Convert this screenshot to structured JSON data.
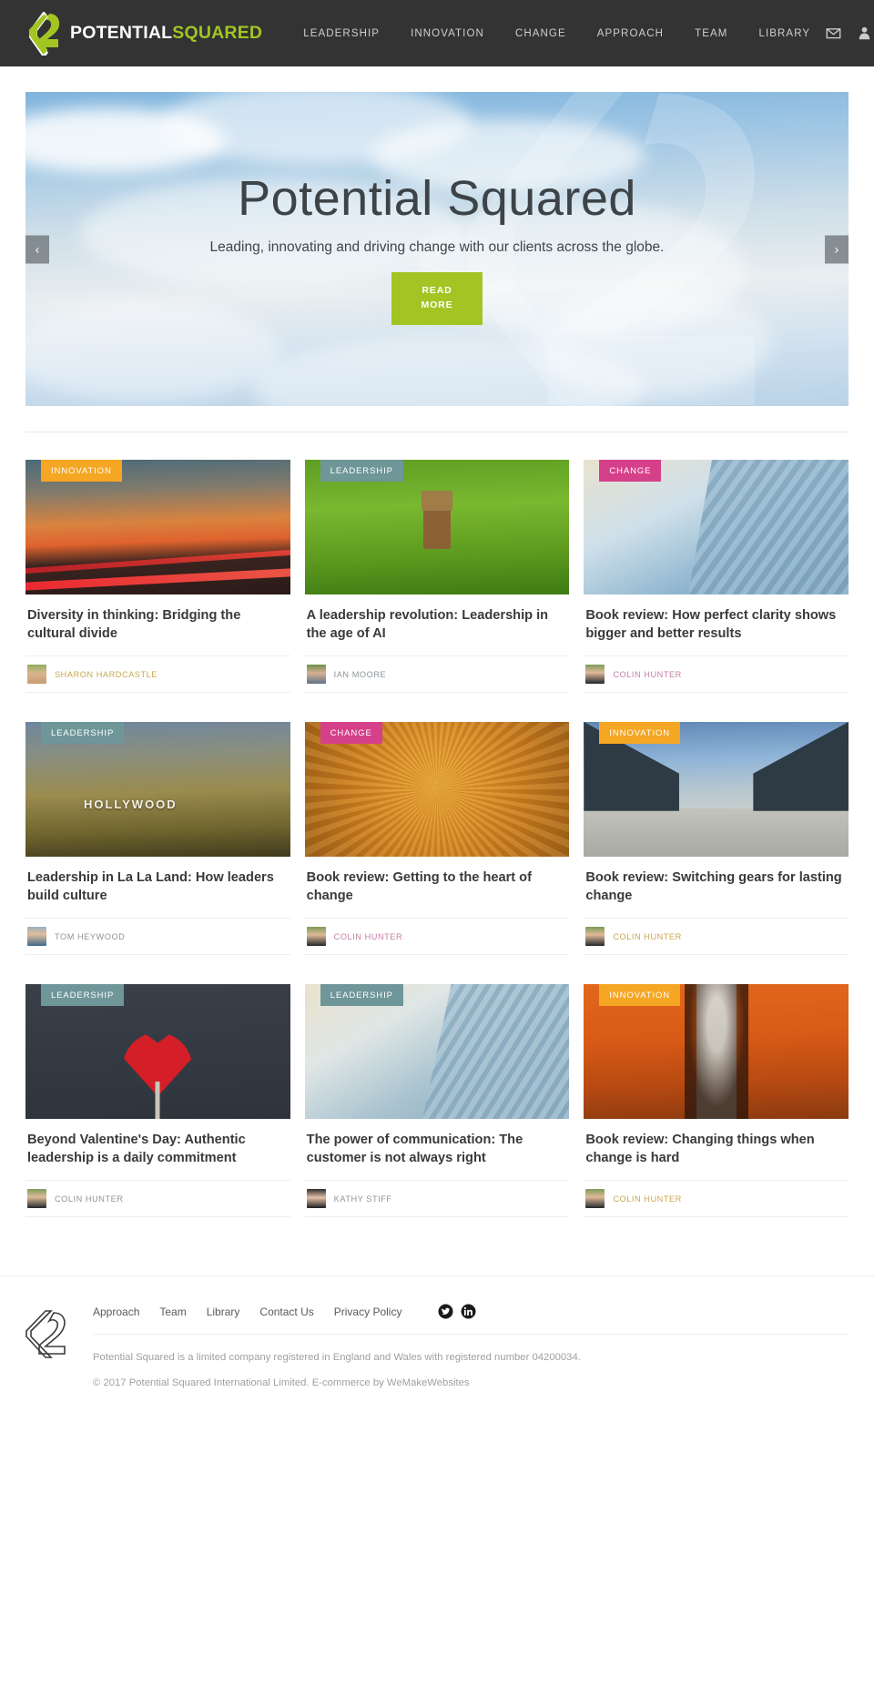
{
  "header": {
    "logo": {
      "part1": "POTENTIAL",
      "part2": "SQUARED",
      "icon": "p-squared-logo-icon"
    },
    "nav": [
      {
        "label": "LEADERSHIP"
      },
      {
        "label": "INNOVATION"
      },
      {
        "label": "CHANGE"
      },
      {
        "label": "APPROACH"
      },
      {
        "label": "TEAM"
      },
      {
        "label": "LIBRARY"
      }
    ],
    "icons": [
      {
        "name": "mail-icon"
      },
      {
        "name": "user-account-icon"
      },
      {
        "name": "search-icon"
      }
    ],
    "colors": {
      "background": "#333333",
      "accent": "#a2c523",
      "nav_text": "#cfcfcf"
    }
  },
  "hero": {
    "title": "Potential Squared",
    "subtitle": "Leading, innovating and driving change with our clients across the globe.",
    "cta_line1": "READ",
    "cta_line2": "MORE",
    "prev_label": "‹",
    "next_label": "›",
    "cta_color": "#a2c523"
  },
  "categories": {
    "innovation": {
      "label": "INNOVATION",
      "color": "#f5a623"
    },
    "leadership": {
      "label": "LEADERSHIP",
      "color": "#6f9699"
    },
    "change": {
      "label": "CHANGE",
      "color": "#d6408a"
    }
  },
  "articles": [
    {
      "category": "INNOVATION",
      "category_key": "innovation",
      "title": "Diversity in thinking: Bridging the cultural divide",
      "author": "SHARON HARDCASTLE",
      "author_color": "#c9a74e",
      "image": "bridge-sunset-light-trails-photo"
    },
    {
      "category": "LEADERSHIP",
      "category_key": "leadership",
      "title": "A leadership revolution: Leadership in the age of AI",
      "author": "IAN MOORE",
      "author_color": "#8d9499",
      "image": "wooden-robot-on-grass-photo"
    },
    {
      "category": "CHANGE",
      "category_key": "change",
      "title": "Book review: How perfect clarity shows bigger and better results",
      "author": "COLIN HUNTER",
      "author_color": "#c47fa5",
      "image": "glass-skyscrapers-upward-photo"
    },
    {
      "category": "LEADERSHIP",
      "category_key": "leadership",
      "title": "Leadership in La La Land: How leaders build culture",
      "author": "TOM HEYWOOD",
      "author_color": "#8d9499",
      "image": "hollywood-sign-hills-photo"
    },
    {
      "category": "CHANGE",
      "category_key": "change",
      "title": "Book review: Getting to the heart of change",
      "author": "COLIN HUNTER",
      "author_color": "#c47fa5",
      "image": "golden-spiral-tunnel-photo"
    },
    {
      "category": "INNOVATION",
      "category_key": "innovation",
      "title": "Book review: Switching gears for lasting change",
      "author": "COLIN HUNTER",
      "author_color": "#c9a74e",
      "image": "converging-metal-walls-walkway-photo"
    },
    {
      "category": "LEADERSHIP",
      "category_key": "leadership",
      "title": "Beyond Valentine's Day: Authentic leadership is a daily commitment",
      "author": "COLIN HUNTER",
      "author_color": "#8d9499",
      "image": "red-heart-lollipop-on-dark-photo"
    },
    {
      "category": "LEADERSHIP",
      "category_key": "leadership",
      "title": "The power of communication: The customer is not always right",
      "author": "KATHY STIFF",
      "author_color": "#8d9499",
      "image": "glass-skyscraper-clouds-photo"
    },
    {
      "category": "INNOVATION",
      "category_key": "innovation",
      "title": "Book review: Changing things when change is hard",
      "author": "COLIN HUNTER",
      "author_color": "#c9a74e",
      "image": "orange-torii-gates-path-photo"
    }
  ],
  "footer": {
    "logo_icon": "p-squared-outline-logo-icon",
    "links": [
      {
        "label": "Approach"
      },
      {
        "label": "Team"
      },
      {
        "label": "Library"
      },
      {
        "label": "Contact Us"
      },
      {
        "label": "Privacy Policy"
      }
    ],
    "social": [
      {
        "name": "twitter-icon"
      },
      {
        "name": "linkedin-icon"
      }
    ],
    "legal_line1": "Potential Squared is a limited company registered in England and Wales with registered number 04200034.",
    "legal_line2": "© 2017 Potential Squared International Limited. E-commerce by WeMakeWebsites"
  }
}
